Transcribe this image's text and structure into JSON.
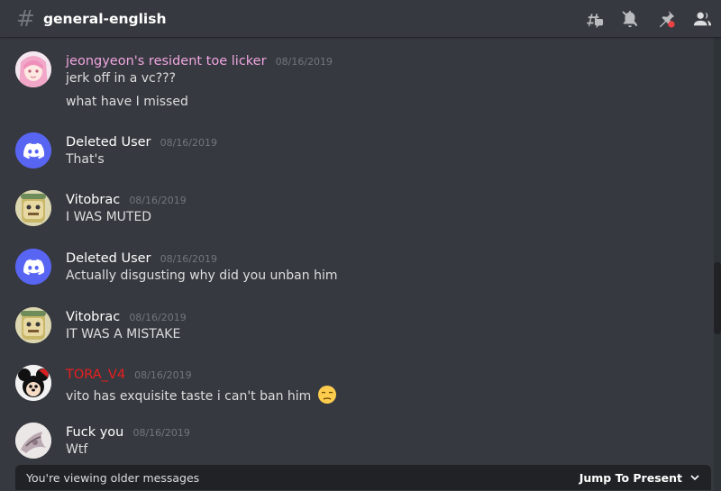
{
  "header": {
    "channel_name": "general-english",
    "icons": [
      "threads-icon",
      "notifications-muted-icon",
      "pinned-messages-icon",
      "member-list-icon"
    ]
  },
  "colors": {
    "background": "#36393f",
    "discord_blurple": "#5865f2",
    "pink_role": "#f0a5e0",
    "red_role": "#ea1f1f",
    "timestamp": "#72767d"
  },
  "messages": [
    {
      "username": "jeongyeon's resident toe licker",
      "timestamp": "08/16/2019",
      "name_color": "#f0a5e0",
      "avatar": "anime-pink-hair-avatar",
      "lines": [
        "jerk off in a vc???",
        "what have I missed"
      ]
    },
    {
      "username": "Deleted User",
      "timestamp": "08/16/2019",
      "name_color": "#ffffff",
      "avatar": "discord-default-avatar",
      "lines": [
        "That's"
      ]
    },
    {
      "username": "Vitobrac",
      "timestamp": "08/16/2019",
      "name_color": "#ffffff",
      "avatar": "cartoon-face-avatar",
      "lines": [
        "I WAS MUTED"
      ]
    },
    {
      "username": "Deleted User",
      "timestamp": "08/16/2019",
      "name_color": "#ffffff",
      "avatar": "discord-default-avatar",
      "lines": [
        "Actually disgusting why did you unban him"
      ]
    },
    {
      "username": "Vitobrac",
      "timestamp": "08/16/2019",
      "name_color": "#ffffff",
      "avatar": "cartoon-face-avatar",
      "lines": [
        "IT WAS A MISTAKE"
      ]
    },
    {
      "username": "TORA_V4",
      "timestamp": "08/16/2019",
      "name_color": "#ea1f1f",
      "avatar": "cartoon-character-avatar",
      "lines": [
        "vito has exquisite taste i can't ban him"
      ],
      "emoji": "pensive-face-emoji"
    },
    {
      "username": "Fuck you",
      "timestamp": "08/16/2019",
      "name_color": "#ffffff",
      "avatar": "sketch-avatar",
      "lines": [
        "Wtf"
      ]
    }
  ],
  "older_bar": {
    "text": "You're viewing older messages",
    "jump_label": "Jump To Present"
  }
}
